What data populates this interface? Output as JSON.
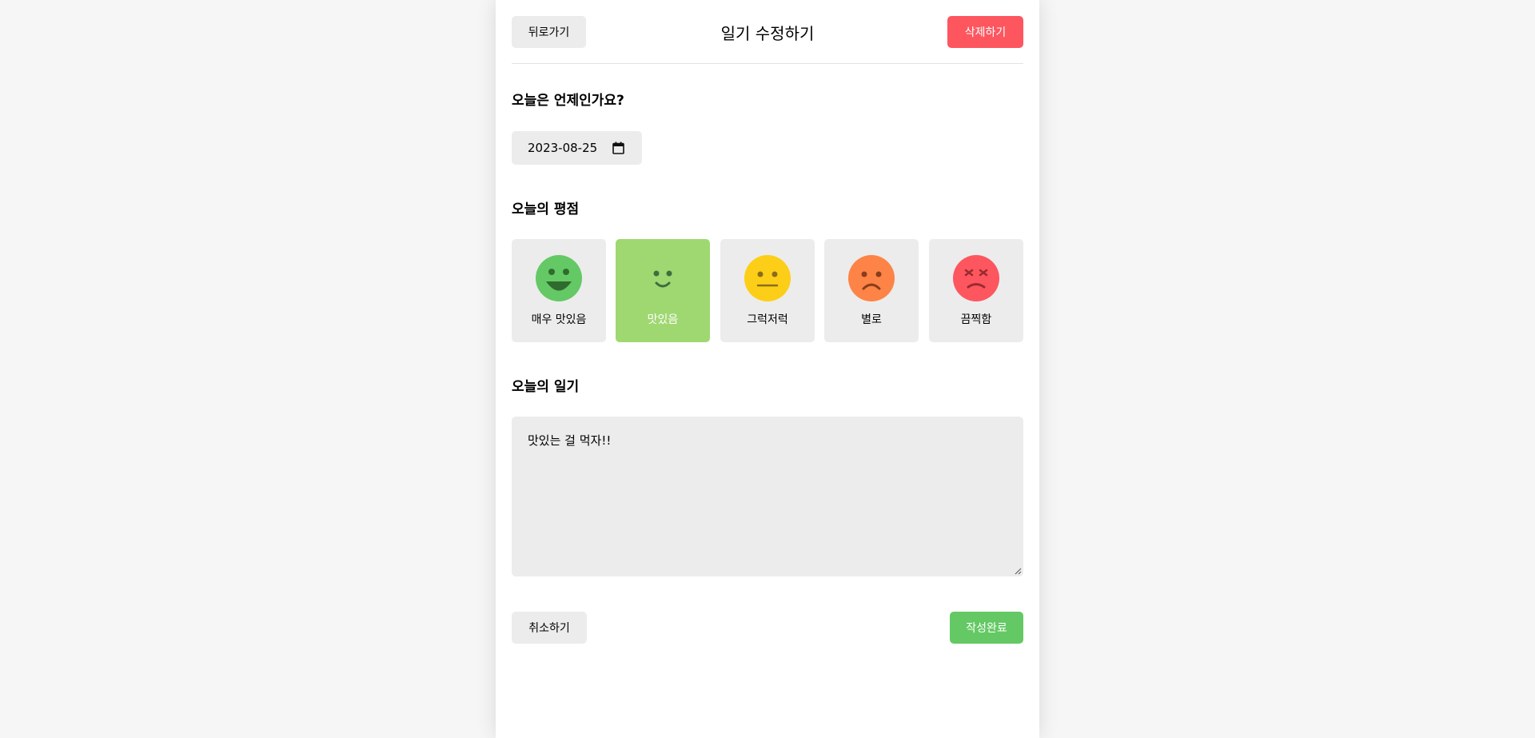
{
  "header": {
    "back_label": "뒤로가기",
    "title": "일기 수정하기",
    "delete_label": "삭제하기"
  },
  "date_section": {
    "title": "오늘은 언제인가요?",
    "date_value": "2023-08-25"
  },
  "emotion_section": {
    "title": "오늘의 평점",
    "selected_index": 1,
    "items": [
      {
        "label": "매우 맛있음",
        "icon": "very-happy-face-icon",
        "color": "#64c964"
      },
      {
        "label": "맛있음",
        "icon": "happy-face-icon",
        "color": "#9fd871"
      },
      {
        "label": "그럭저럭",
        "icon": "neutral-face-icon",
        "color": "#fdce17"
      },
      {
        "label": "별로",
        "icon": "sad-face-icon",
        "color": "#fd8446"
      },
      {
        "label": "끔찍함",
        "icon": "angry-face-icon",
        "color": "#fd565f"
      }
    ]
  },
  "diary_section": {
    "title": "오늘의 일기",
    "content": "맛있는 걸 먹자!!"
  },
  "footer": {
    "cancel_label": "취소하기",
    "submit_label": "작성완료"
  },
  "colors": {
    "negative": "#fd565f",
    "positive": "#64c964",
    "neutral_bg": "#ececec",
    "page_bg": "#f6f6f6"
  }
}
